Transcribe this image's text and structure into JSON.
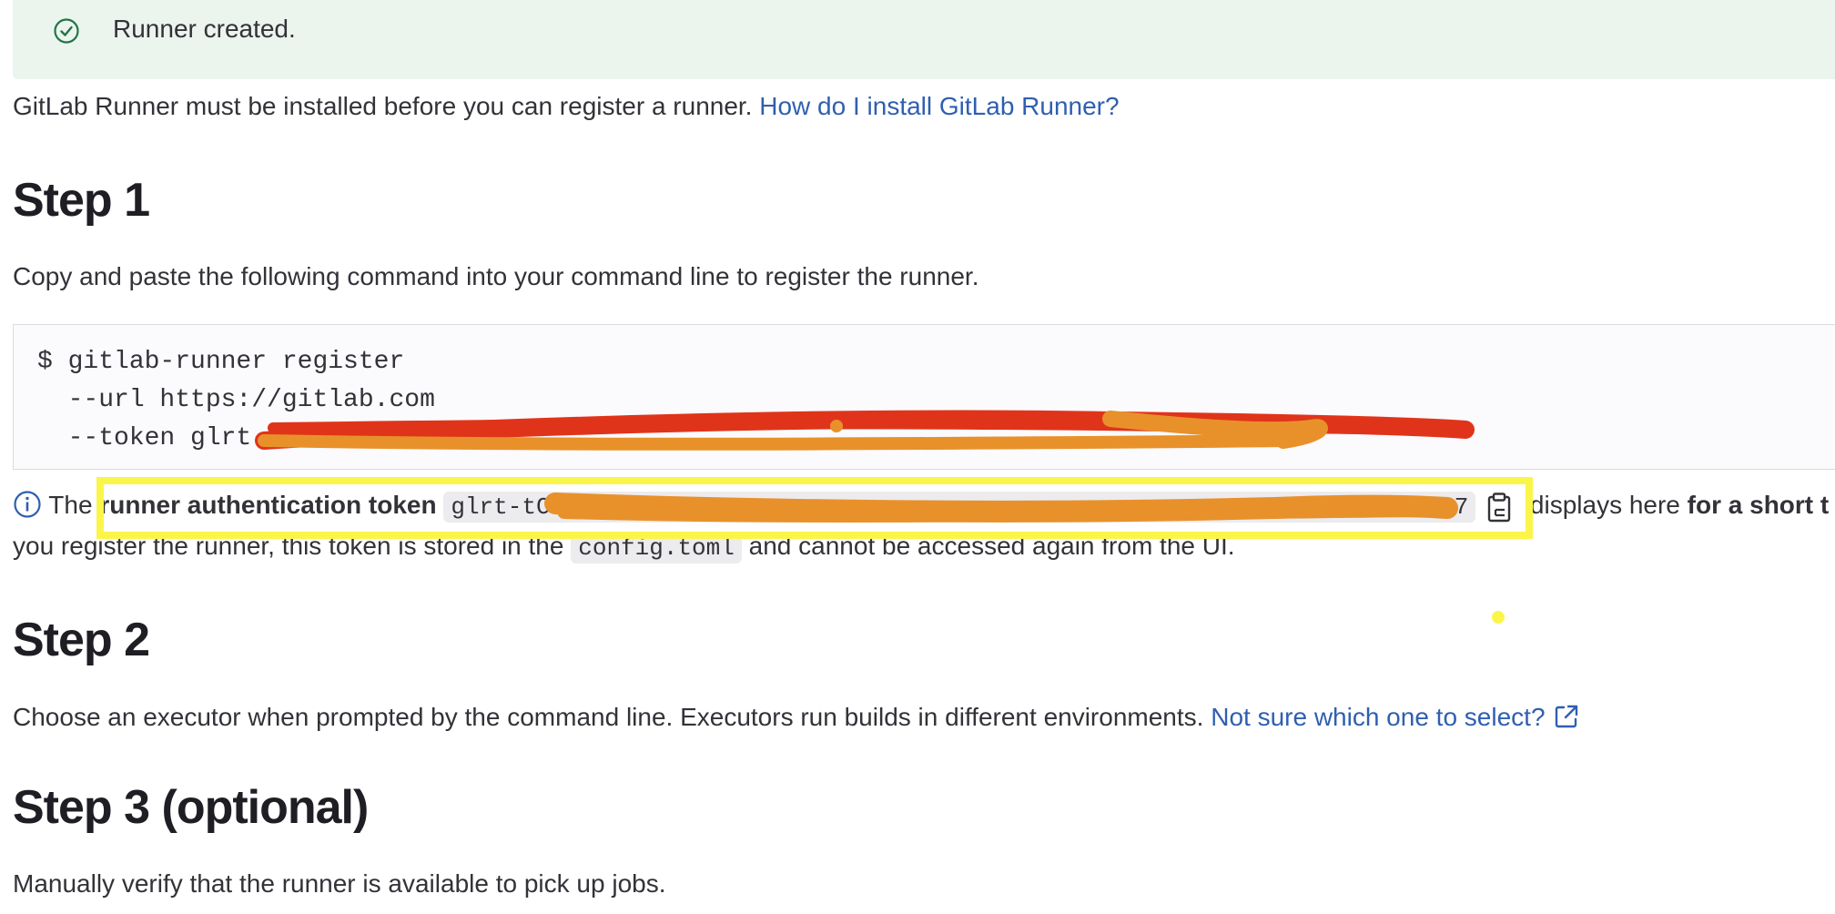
{
  "alert": {
    "message": "Runner created."
  },
  "intro": {
    "text": "GitLab Runner must be installed before you can register a runner. ",
    "link": "How do I install GitLab Runner?"
  },
  "step1": {
    "title": "Step 1",
    "description": "Copy and paste the following command into your command line to register the runner.",
    "code_lines": [
      "$ gitlab-runner register",
      "  --url https://gitlab.com",
      "  --token glrt-"
    ],
    "token_note": {
      "prefix": "The ",
      "bold": "runner authentication token",
      "token": "glrt-tC",
      "token_end": "7",
      "suffix": " displays here ",
      "bold_end": "for a short t",
      "line2_a": "you register the runner, this token is stored in the ",
      "line2_code": "config.toml",
      "line2_b": " and cannot be accessed again from the UI."
    }
  },
  "step2": {
    "title": "Step 2",
    "description": "Choose an executor when prompted by the command line. Executors run builds in different environments. ",
    "link": "Not sure which one to select?"
  },
  "step3": {
    "title": "Step 3 (optional)",
    "description": "Manually verify that the runner is available to pick up jobs."
  },
  "icons": [
    "check-circle-icon",
    "info-icon",
    "copy-clipboard-icon",
    "external-link-icon"
  ],
  "colors": {
    "link": "#2f5fb0",
    "alert_bg": "#ecf4ee",
    "success": "#217645",
    "highlight": "#fbf54a",
    "scribble_red": "#e0341a",
    "scribble_orange": "#e8912a"
  }
}
